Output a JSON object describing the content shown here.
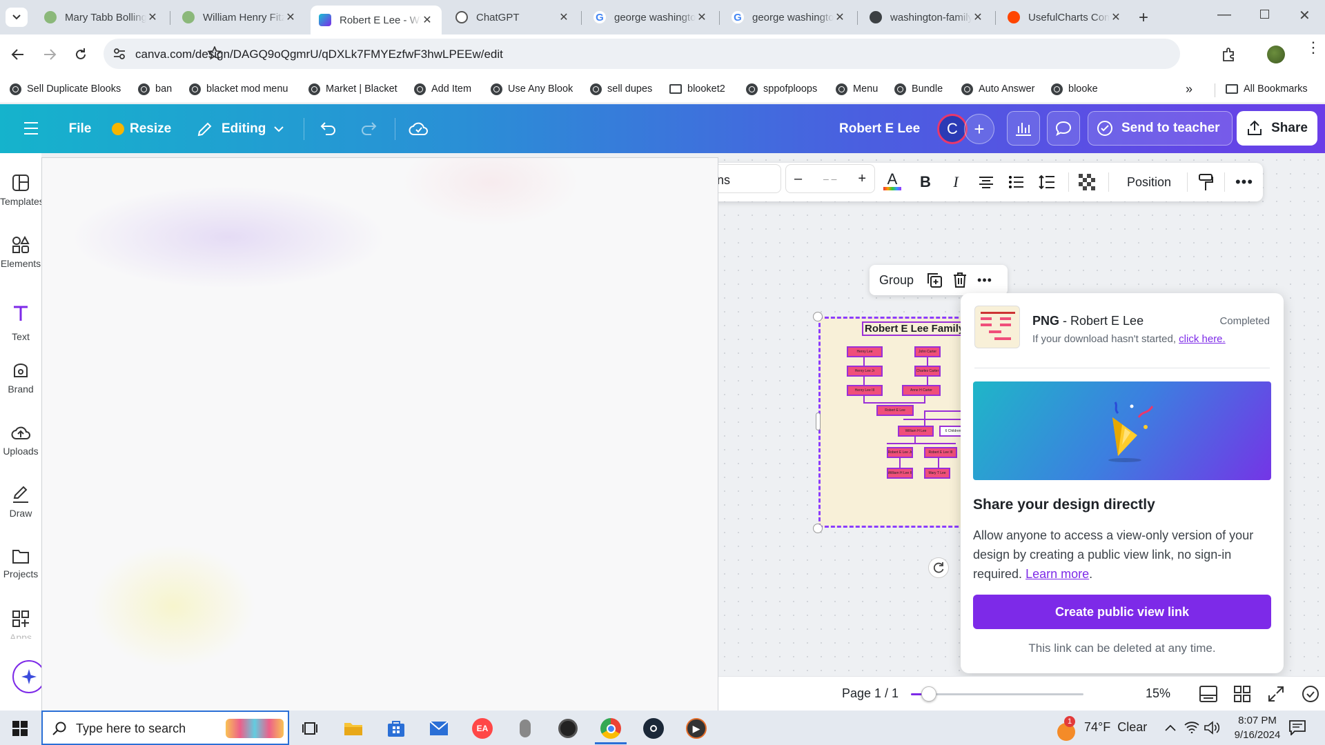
{
  "browser": {
    "tabs": [
      {
        "title": "Mary Tabb Bolling",
        "icon": "tree-icon",
        "active": false
      },
      {
        "title": "William Henry Fitzhugh",
        "icon": "tree-icon",
        "active": false
      },
      {
        "title": "Robert E Lee - Whiteboard",
        "icon": "canva-icon",
        "active": true
      },
      {
        "title": "ChatGPT",
        "icon": "chatgpt-icon",
        "active": false
      },
      {
        "title": "george washington",
        "icon": "google-icon",
        "active": false
      },
      {
        "title": "george washington",
        "icon": "google-icon",
        "active": false
      },
      {
        "title": "washington-family",
        "icon": "globe-icon",
        "active": false
      },
      {
        "title": "UsefulCharts Community",
        "icon": "reddit-icon",
        "active": false
      }
    ],
    "url": "canva.com/design/DAGQ9oQgmrU/qDXLk7FMYEzfwF3hwLPEEw/edit",
    "bookmarks": [
      {
        "label": "Sell Duplicate Blooks",
        "icon": "globe-icon"
      },
      {
        "label": "ban",
        "icon": "globe-icon"
      },
      {
        "label": "blacket mod menu",
        "icon": "globe-icon"
      },
      {
        "label": "Market | Blacket",
        "icon": "globe-icon"
      },
      {
        "label": "Add Item",
        "icon": "globe-icon"
      },
      {
        "label": "Use Any Blook",
        "icon": "globe-icon"
      },
      {
        "label": "sell dupes",
        "icon": "globe-icon"
      },
      {
        "label": "blooket2",
        "icon": "folder-icon"
      },
      {
        "label": "sppofploops",
        "icon": "globe-icon"
      },
      {
        "label": "Menu",
        "icon": "globe-icon"
      },
      {
        "label": "Bundle",
        "icon": "globe-icon"
      },
      {
        "label": "Auto Answer",
        "icon": "globe-icon"
      },
      {
        "label": "blooke",
        "icon": "globe-icon"
      }
    ],
    "all_bookmarks": "All Bookmarks"
  },
  "canva": {
    "file": "File",
    "resize": "Resize",
    "editing": "Editing",
    "design_title": "Robert E Lee",
    "avatar_letter": "C",
    "send_to_teacher": "Send to teacher",
    "share": "Share",
    "rail": [
      "Templates",
      "Elements",
      "Text",
      "Brand",
      "Uploads",
      "Draw",
      "Projects",
      "Apps"
    ],
    "toolbar": {
      "font_fragment": "ns",
      "font_size": "– –",
      "position": "Position"
    },
    "selection": {
      "group": "Group"
    },
    "design": {
      "title": "Robert E Lee Family",
      "nodes": [
        "Henry Lee",
        "John Carter",
        "Henry Lee Jr",
        "Charles Carter",
        "Henry Lee III",
        "Anne H Carter",
        "Robert E Lee",
        "William H Lee",
        "6 Children",
        "Robert E Lee Jr",
        "Robert E Lee III",
        "William H Lee II",
        "Mary T Lee"
      ]
    },
    "bottom": {
      "page": "Page 1 / 1",
      "zoom": "15%",
      "zoom_level": 0.15
    },
    "share_panel": {
      "format": "PNG",
      "file_name": "Robert E Lee",
      "status": "Completed",
      "hint_prefix": "If your download hasn't started,",
      "hint_link": "click here.",
      "heading": "Share your design directly",
      "body": "Allow anyone to access a view-only version of your design by creating a public view link, no sign-in required.",
      "learn_more": "Learn more",
      "button": "Create public view link",
      "footer": "This link can be deleted at any time."
    }
  },
  "taskbar": {
    "search_placeholder": "Type here to search",
    "weather": "74°F  Clear",
    "weather_badge": "1",
    "time": "8:07 PM",
    "date": "9/16/2024"
  },
  "colors": {
    "accent": "#7d2ae8",
    "header_left": "#15b3cc",
    "header_right": "#6a3ee8",
    "node": "#ef4f7a",
    "node_border": "#9a2fd8"
  }
}
